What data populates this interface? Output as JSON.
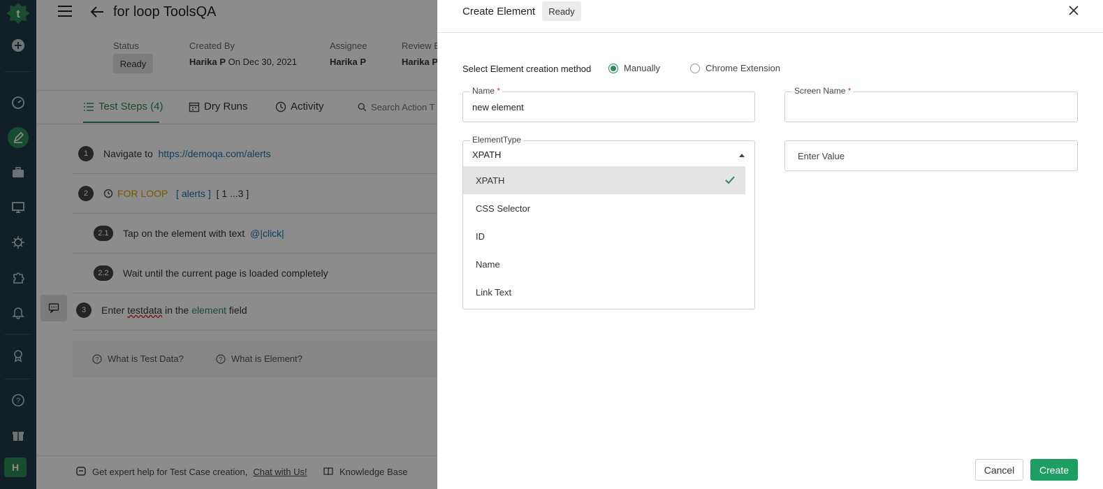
{
  "app": {
    "logo_icon": "testsigma-gear-icon",
    "user_initial": "H"
  },
  "header": {
    "title": "for loop ToolsQA",
    "status_label": "Status",
    "status_value": "Ready",
    "created_by_label": "Created By",
    "created_by_name": "Harika P",
    "created_on": "On Dec 30, 2021",
    "assignee_label": "Assignee",
    "assignee_name": "Harika P",
    "review_label": "Review B",
    "review_name": "Harika P"
  },
  "tabs": [
    {
      "label": "Test Steps (4)",
      "icon": "list-icon"
    },
    {
      "label": "Dry Runs",
      "icon": "calendar-icon"
    },
    {
      "label": "Activity",
      "icon": "clock-icon"
    },
    {
      "label": "Search Action T",
      "icon": "search-icon"
    }
  ],
  "steps": {
    "s1": {
      "num": "1",
      "text": "Navigate to",
      "link": "https://demoqa.com/alerts"
    },
    "s2": {
      "num": "2",
      "keyword": "FOR LOOP",
      "open": "[",
      "data": "alerts",
      "close": "]",
      "range": "[ 1 ...3 ]"
    },
    "s21": {
      "num": "2.1",
      "text": "Tap on the element with text",
      "value": "@|click|"
    },
    "s22": {
      "num": "2.2",
      "text": "Wait until the current page is loaded completely"
    },
    "s3": {
      "num": "3",
      "pre": "Enter",
      "testdata": "testdata",
      "mid": "in the",
      "element": "element",
      "post": "field"
    }
  },
  "help": {
    "test_data": "What is Test Data?",
    "element": "What is Element?"
  },
  "bottom": {
    "expert_text": "Get expert help for Test Case creation,",
    "chat_link": "Chat with Us!",
    "knowledge": "Knowledge Base"
  },
  "panel": {
    "title": "Create Element",
    "badge": "Ready",
    "method_label": "Select Element creation method",
    "method_manual": "Manually",
    "method_extension": "Chrome Extension",
    "name_label": "Name",
    "name_value": "new element",
    "screen_name_label": "Screen Name",
    "screen_name_value": "",
    "element_type_label": "ElementType",
    "element_type_value": "XPATH",
    "value_placeholder": "Enter Value",
    "options": [
      "XPATH",
      "CSS Selector",
      "ID",
      "Name",
      "Link Text"
    ],
    "required_mark": "*",
    "cancel": "Cancel",
    "create": "Create"
  },
  "colors": {
    "accent": "#2e8b57",
    "nav_bg": "#1f3b47",
    "create_btn": "#1e9e63"
  }
}
